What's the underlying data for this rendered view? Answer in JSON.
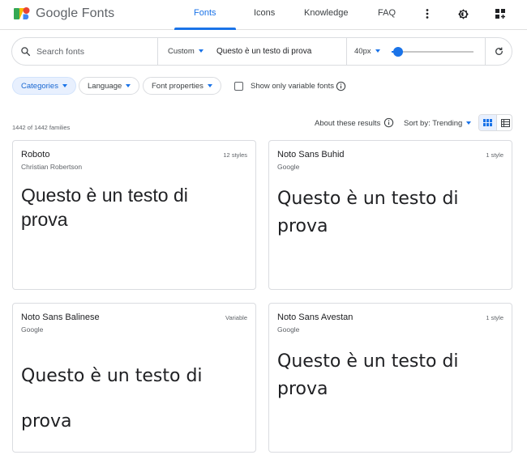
{
  "brand": {
    "name": "Google Fonts"
  },
  "nav": {
    "tabs": [
      {
        "label": "Fonts",
        "active": true
      },
      {
        "label": "Icons",
        "active": false
      },
      {
        "label": "Knowledge",
        "active": false
      },
      {
        "label": "FAQ",
        "active": false
      }
    ],
    "icons": [
      "more-vert-icon",
      "theme-toggle-icon",
      "grid-apps-icon"
    ]
  },
  "search": {
    "placeholder": "Search fonts",
    "value": "",
    "preview_mode": "Custom",
    "preview_text": "Questo è un testo di prova",
    "font_size": "40px",
    "font_size_value": 40,
    "font_size_fraction": 0.08
  },
  "filters": {
    "categories": "Categories",
    "language": "Language",
    "font_properties": "Font properties",
    "variable_only_label": "Show only variable fonts",
    "variable_only_checked": false
  },
  "results": {
    "count": "1442 of 1442 families",
    "about": "About these results",
    "sort": "Sort by: Trending",
    "view": "grid"
  },
  "cards": [
    {
      "name": "Roboto",
      "author": "Christian Robertson",
      "styles": "12 styles",
      "preview": "Questo è un testo di prova"
    },
    {
      "name": "Noto Sans Buhid",
      "author": "Google",
      "styles": "1 style",
      "preview": "Questo è un testo di prova"
    },
    {
      "name": "Noto Sans Balinese",
      "author": "Google",
      "styles": "Variable",
      "preview": "Questo è un testo di prova"
    },
    {
      "name": "Noto Sans Avestan",
      "author": "Google",
      "styles": "1 style",
      "preview": "Questo è un testo di prova"
    }
  ],
  "colors": {
    "accent": "#1a73e8",
    "chip_active_bg": "#e8f0fe",
    "border": "#dadce0",
    "text_secondary": "#5f6368"
  }
}
